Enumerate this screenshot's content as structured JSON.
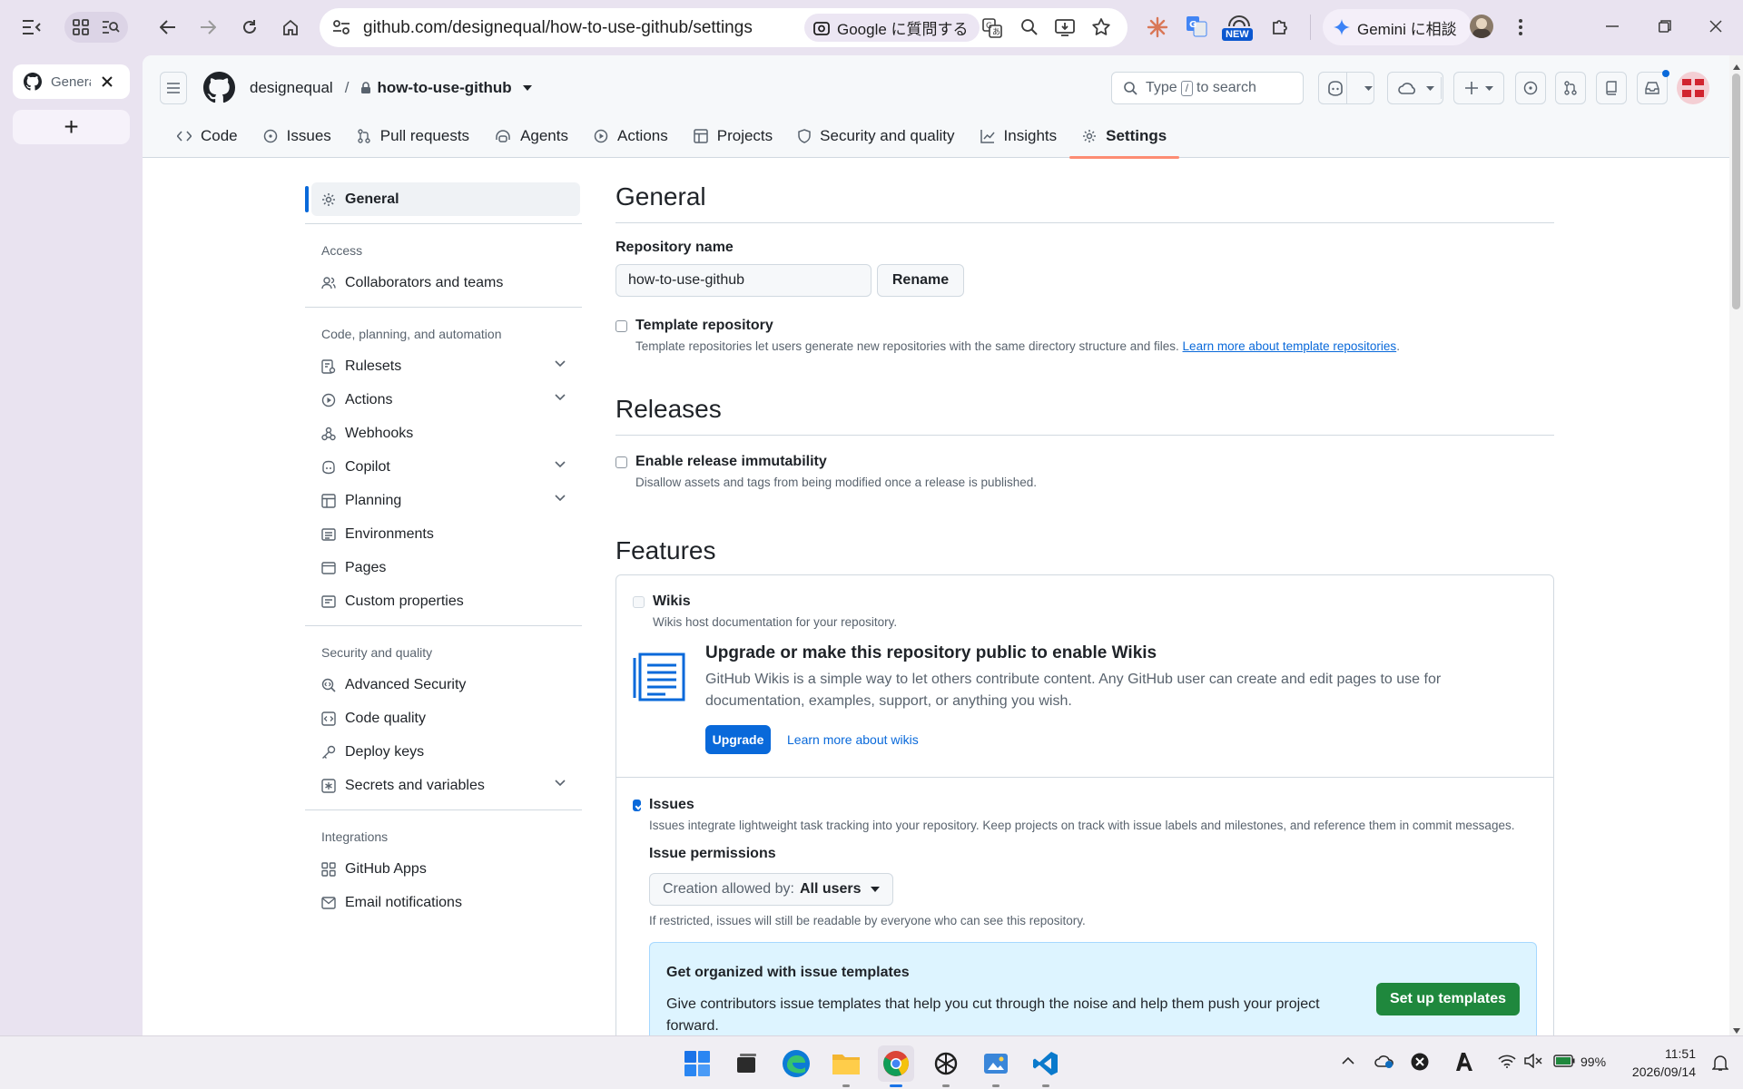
{
  "browser": {
    "url": "github.com/designequal/how-to-use-github/settings",
    "ask_google": "Google に質問する",
    "gemini_label": "Gemini に相談",
    "new_badge": "NEW",
    "tab_title": "Genera",
    "new_tab_symbol": "+"
  },
  "header": {
    "owner": "designequal",
    "separator": "/",
    "repo": "how-to-use-github",
    "search_prefix": "Type",
    "search_key": "/",
    "search_suffix": "to search"
  },
  "repo_nav": [
    {
      "label": "Code",
      "icon": "code-icon",
      "active": false
    },
    {
      "label": "Issues",
      "icon": "issue-icon",
      "active": false
    },
    {
      "label": "Pull requests",
      "icon": "pull-request-icon",
      "active": false
    },
    {
      "label": "Agents",
      "icon": "agent-icon",
      "active": false
    },
    {
      "label": "Actions",
      "icon": "play-icon",
      "active": false
    },
    {
      "label": "Projects",
      "icon": "table-icon",
      "active": false
    },
    {
      "label": "Security and quality",
      "icon": "shield-icon",
      "active": false
    },
    {
      "label": "Insights",
      "icon": "graph-icon",
      "active": false
    },
    {
      "label": "Settings",
      "icon": "gear-icon",
      "active": true
    }
  ],
  "sidebar": {
    "general": "General",
    "access_heading": "Access",
    "collaborators": "Collaborators and teams",
    "code_heading": "Code, planning, and automation",
    "rulesets": "Rulesets",
    "actions": "Actions",
    "webhooks": "Webhooks",
    "copilot": "Copilot",
    "planning": "Planning",
    "environments": "Environments",
    "pages": "Pages",
    "custom_properties": "Custom properties",
    "security_heading": "Security and quality",
    "advanced_security": "Advanced Security",
    "code_quality": "Code quality",
    "deploy_keys": "Deploy keys",
    "secrets": "Secrets and variables",
    "integrations_heading": "Integrations",
    "github_apps": "GitHub Apps",
    "email_notifications": "Email notifications"
  },
  "main": {
    "general_title": "General",
    "repo_name_label": "Repository name",
    "repo_name_value": "how-to-use-github",
    "rename": "Rename",
    "template_label": "Template repository",
    "template_desc": "Template repositories let users generate new repositories with the same directory structure and files.",
    "template_link": "Learn more about template repositories",
    "template_link_end": ".",
    "template_checked": false,
    "releases_title": "Releases",
    "immutability_label": "Enable release immutability",
    "immutability_desc": "Disallow assets and tags from being modified once a release is published.",
    "features_title": "Features",
    "wikis_label": "Wikis",
    "wikis_desc": "Wikis host documentation for your repository.",
    "wiki_upgrade_title": "Upgrade or make this repository public to enable Wikis",
    "wiki_upgrade_desc": "GitHub Wikis is a simple way to let others contribute content. Any GitHub user can create and edit pages to use for documentation, examples, support, or anything you wish.",
    "upgrade_button": "Upgrade",
    "learn_wikis": "Learn more about wikis",
    "issues_label": "Issues",
    "issues_checked": true,
    "issues_desc": "Issues integrate lightweight task tracking into your repository. Keep projects on track with issue labels and milestones, and reference them in commit messages.",
    "issue_permissions": "Issue permissions",
    "creation_prefix": "Creation allowed by:",
    "creation_value": "All users",
    "restricted_note": "If restricted, issues will still be readable by everyone who can see this repository.",
    "templates_title": "Get organized with issue templates",
    "templates_desc": "Give contributors issue templates that help you cut through the noise and help them push your project forward.",
    "setup_templates": "Set up templates"
  },
  "taskbar": {
    "battery": "99%",
    "time": "11:51",
    "date": "2026/09/14"
  },
  "colors": {
    "accent_blue": "#0969da",
    "green_button": "#1f883d",
    "active_tab_underline": "#fd8c73",
    "sidebar_active_bar": "#0969da",
    "templates_banner_bg": "#ddf4ff"
  }
}
